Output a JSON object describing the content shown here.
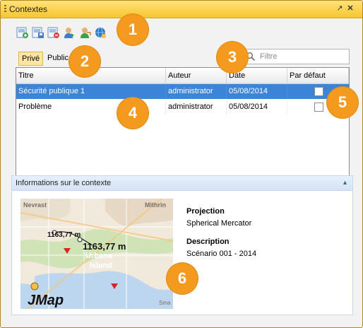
{
  "window": {
    "title": "Contextes"
  },
  "toolbar": {
    "buttons": [
      {
        "icon": "add-context-icon",
        "color": "#3aa34a"
      },
      {
        "icon": "save-context-icon",
        "color": "#4a7cc4"
      },
      {
        "icon": "delete-context-icon",
        "color": "#d24b3a"
      },
      {
        "icon": "user-context-icon",
        "color": "#c98a2a"
      },
      {
        "icon": "share-context-icon",
        "color": "#c98a2a"
      },
      {
        "icon": "global-context-icon",
        "color": "#2a78c8"
      }
    ]
  },
  "visibility": {
    "private_label": "Privé",
    "public_label": "Public"
  },
  "filter": {
    "placeholder": "Filtre"
  },
  "table": {
    "columns": [
      "Titre",
      "Auteur",
      "Date",
      "Par défaut"
    ],
    "rows": [
      {
        "title": "Sécurité publique 1",
        "author": "administrator",
        "date": "05/08/2014",
        "default": false,
        "selected": true
      },
      {
        "title": "Problème",
        "author": "administrator",
        "date": "05/08/2014",
        "default": false,
        "selected": false
      }
    ]
  },
  "info": {
    "header": "Informations sur le contexte",
    "projection_label": "Projection",
    "projection_value": "Spherical Mercator",
    "description_label": "Description",
    "description_value": "Scénario 001 - 2014",
    "map": {
      "place_labels": [
        "Nevrast",
        "Mithrin",
        "Urbana",
        "Island",
        "Sma"
      ],
      "measure_small": "1163,77 m",
      "measure_large": "1163,77 m",
      "logo": "JMap"
    }
  },
  "callouts": [
    "1",
    "2",
    "3",
    "4",
    "5",
    "6"
  ],
  "colors": {
    "accent": "#f39a1f",
    "selection": "#3c84d8",
    "titlebar": "#f7c531"
  }
}
